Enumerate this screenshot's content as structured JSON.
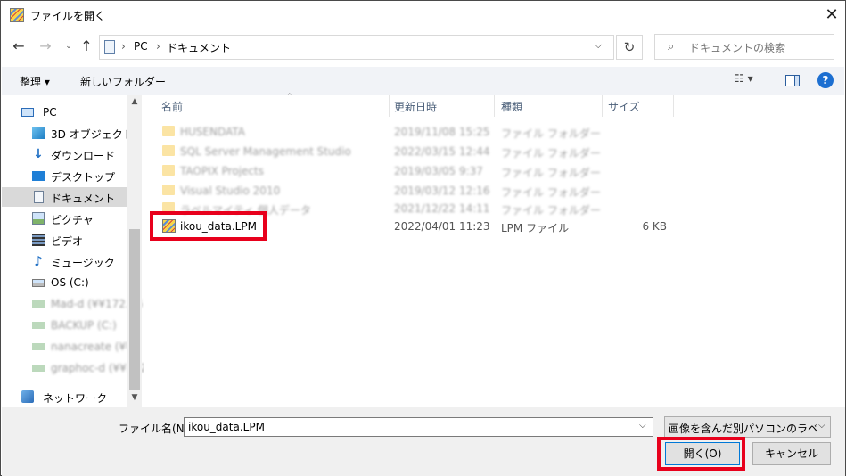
{
  "window": {
    "title": "ファイルを開く",
    "close_glyph": "✕"
  },
  "nav": {
    "back": "←",
    "forward": "→",
    "recent": "⌄",
    "up": "↑",
    "refresh": "↻"
  },
  "address": {
    "segments": [
      "PC",
      "ドキュメント"
    ],
    "sep": "›",
    "dropdown": "⌵"
  },
  "search": {
    "placeholder": "ドキュメントの検索",
    "icon": "search-icon"
  },
  "toolbar": {
    "organize": "整理 ▾",
    "new_folder": "新しいフォルダー",
    "view": "☷ ▾",
    "help": "?"
  },
  "sidebar": {
    "items": [
      {
        "label": "PC",
        "icon": "pc-icon",
        "selected": false,
        "blurred": false
      },
      {
        "label": "3D オブジェクト",
        "icon": "3d-objects-icon",
        "selected": false,
        "blurred": false
      },
      {
        "label": "ダウンロード",
        "icon": "download-icon",
        "selected": false,
        "blurred": false
      },
      {
        "label": "デスクトップ",
        "icon": "desktop-icon",
        "selected": false,
        "blurred": false
      },
      {
        "label": "ドキュメント",
        "icon": "documents-icon",
        "selected": true,
        "blurred": false
      },
      {
        "label": "ピクチャ",
        "icon": "pictures-icon",
        "selected": false,
        "blurred": false
      },
      {
        "label": "ビデオ",
        "icon": "video-icon",
        "selected": false,
        "blurred": false
      },
      {
        "label": "ミュージック",
        "icon": "music-icon",
        "selected": false,
        "blurred": false
      },
      {
        "label": "OS (C:)",
        "icon": "drive-icon",
        "selected": false,
        "blurred": false
      },
      {
        "label": "Mad-d (¥¥172.16",
        "icon": "network-drive-icon",
        "selected": false,
        "blurred": true
      },
      {
        "label": "BACKUP (C:)",
        "icon": "network-drive-icon",
        "selected": false,
        "blurred": true
      },
      {
        "label": "nanacreate (¥¥o",
        "icon": "network-drive-icon",
        "selected": false,
        "blurred": true
      },
      {
        "label": "graphoc-d (¥¥172.",
        "icon": "network-drive-icon",
        "selected": false,
        "blurred": true
      },
      {
        "label": "ネットワーク",
        "icon": "network-icon",
        "selected": false,
        "blurred": false
      }
    ]
  },
  "list": {
    "columns": [
      "名前",
      "更新日時",
      "種類",
      "サイズ"
    ],
    "rows": [
      {
        "name": "HUSENDATA",
        "date": "2019/11/08 15:25",
        "type": "ファイル フォルダー",
        "size": "",
        "blurred": true
      },
      {
        "name": "SQL Server Management Studio",
        "date": "2022/03/15 12:44",
        "type": "ファイル フォルダー",
        "size": "",
        "blurred": true
      },
      {
        "name": "TAOPIX Projects",
        "date": "2019/03/05 9:37",
        "type": "ファイル フォルダー",
        "size": "",
        "blurred": true
      },
      {
        "name": "Visual Studio 2010",
        "date": "2019/03/12 12:16",
        "type": "ファイル フォルダー",
        "size": "",
        "blurred": true
      },
      {
        "name": "ラベルマイティ 個人データ",
        "date": "2021/12/22 14:11",
        "type": "ファイル フォルダー",
        "size": "",
        "blurred": true
      },
      {
        "name": "ikou_data.LPM",
        "date": "2022/04/01 11:23",
        "type": "LPM ファイル",
        "size": "6 KB",
        "blurred": false
      }
    ]
  },
  "bottom": {
    "filename_label": "ファイル名(N):",
    "filename_value": "ikou_data.LPM",
    "filter_value": "画像を含んだ別パソコンのラベルドク",
    "open_label": "開く(O)",
    "cancel_label": "キャンセル"
  },
  "colors": {
    "highlight": "#e8001c",
    "selected_bg": "#d9d9d9",
    "accent": "#0078d7"
  }
}
